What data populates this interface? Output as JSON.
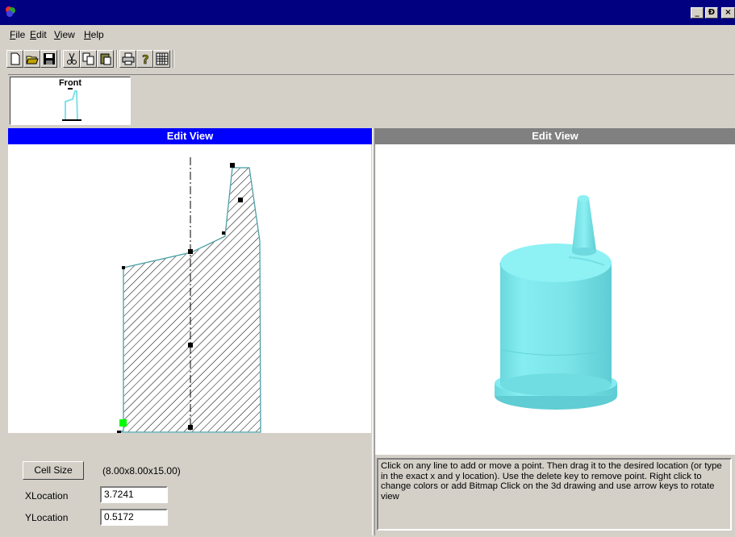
{
  "colors": {
    "title_bar": "#000080",
    "active_header": "#0000ff",
    "inactive_header": "#808080",
    "profile_outline": "#7fe1e8",
    "model_color": "#7fe6ea",
    "selected_point": "#00ff00"
  },
  "window": {
    "controls": [
      "_",
      "Ɖ",
      "×"
    ]
  },
  "menu": {
    "items": [
      {
        "label": "File",
        "key": "F"
      },
      {
        "label": "Edit",
        "key": "E"
      },
      {
        "label": "View",
        "key": "V"
      },
      {
        "label": "Help",
        "key": "H"
      }
    ]
  },
  "toolbar": {
    "icons": [
      "new-file-icon",
      "open-folder-icon",
      "save-icon",
      "cut-icon",
      "copy-icon",
      "paste-icon",
      "print-icon",
      "help-icon",
      "grid-icon"
    ]
  },
  "thumbnails": [
    {
      "label": "Front"
    }
  ],
  "left_pane": {
    "title": "Edit View"
  },
  "right_pane": {
    "title": "Edit View"
  },
  "controls": {
    "cell_size_button": "Cell Size",
    "cell_size_value": "(8.00x8.00x15.00)",
    "x_label": "XLocation",
    "x_value": "3.7241",
    "y_label": "YLocation",
    "y_value": "0.5172"
  },
  "help_text": "Click on any line to add or move a point. Then drag it to the desired location (or type in the exact x and y location). Use the delete key to remove point. Right click to change colors or add Bitmap Click on the 3d drawing and use arrow keys to rotate view"
}
